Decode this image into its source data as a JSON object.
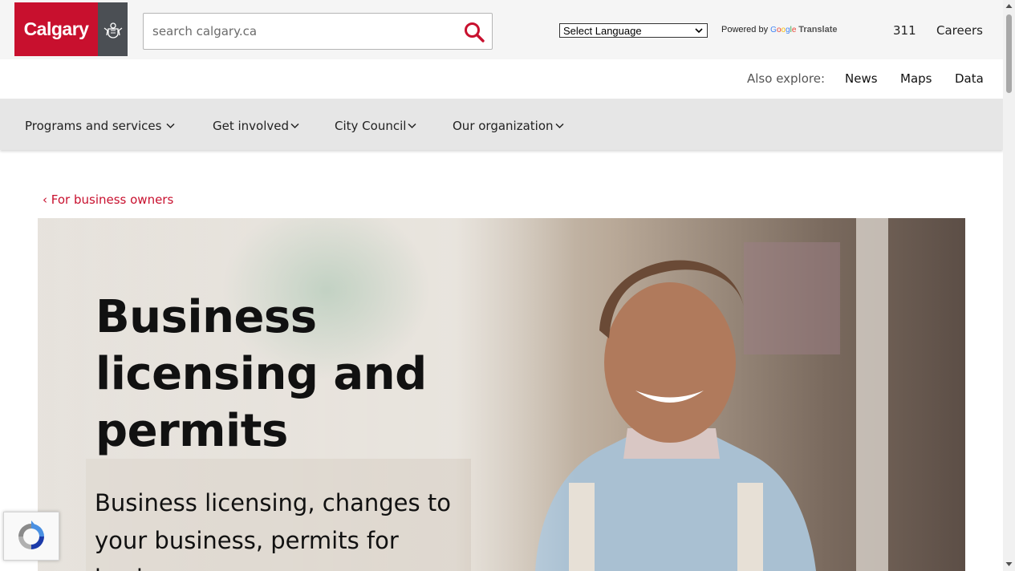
{
  "header": {
    "logo_text": "Calgary",
    "search_placeholder": "search calgary.ca",
    "language_select": "Select Language",
    "powered_by": "Powered by",
    "google": "Google",
    "translate": "Translate",
    "link_311": "311",
    "link_careers": "Careers"
  },
  "explore": {
    "label": "Also explore:",
    "links": [
      "News",
      "Maps",
      "Data"
    ]
  },
  "nav": {
    "items": [
      "Programs and services",
      "Get involved",
      "City Council",
      "Our organization"
    ]
  },
  "breadcrumb": {
    "text": "For business owners"
  },
  "hero": {
    "title_line1": "Business",
    "title_line2": "licensing and",
    "title_line3": "permits",
    "subtitle": "Business licensing, changes to your business, permits for business"
  },
  "colors": {
    "brand_red": "#c8102e",
    "nav_bg": "#e6e6e6",
    "top_bg": "#f5f5f5",
    "logo_grey": "#4b4f54"
  },
  "icons": {
    "search": "search-icon",
    "chevron": "chevron-down-icon",
    "crest": "crest-icon",
    "recaptcha": "recaptcha-icon"
  }
}
